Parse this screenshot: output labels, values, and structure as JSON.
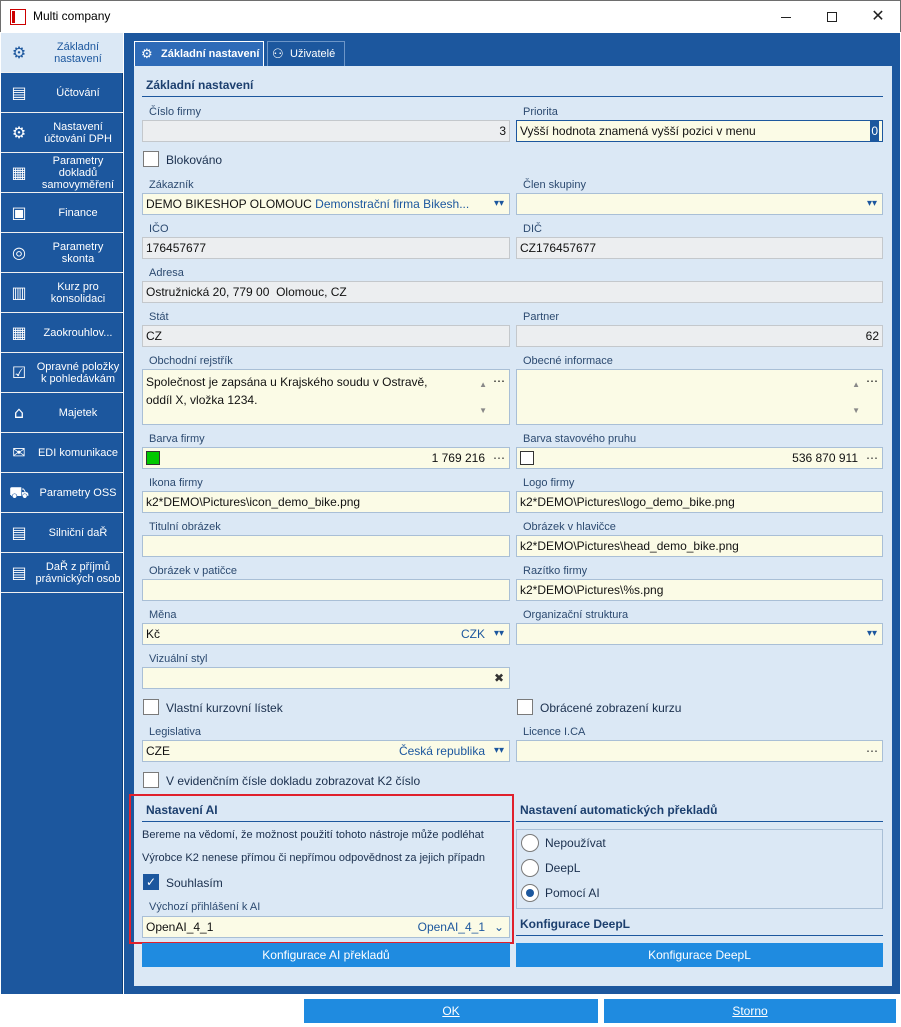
{
  "window": {
    "title": "Multi company"
  },
  "sidebar": {
    "items": [
      {
        "label": "Základní nastavení",
        "icon": "gear-icon",
        "glyph": "⚙"
      },
      {
        "label": "Účtování",
        "icon": "cash-register-icon",
        "glyph": "▤"
      },
      {
        "label": "Nastavení účtování DPH",
        "icon": "tax-settings-icon",
        "glyph": "⚙"
      },
      {
        "label": "Parametry dokladů samovyměření",
        "icon": "document-icon",
        "glyph": "▦"
      },
      {
        "label": "Finance",
        "icon": "printer-icon",
        "glyph": "▣"
      },
      {
        "label": "Parametry skonta",
        "icon": "coins-icon",
        "glyph": "◎"
      },
      {
        "label": "Kurz pro konsolidaci",
        "icon": "chart-document-icon",
        "glyph": "▥"
      },
      {
        "label": "Zaokrouhlov...",
        "icon": "calculator-icon",
        "glyph": "▦"
      },
      {
        "label": "Opravné položky k pohledávkám",
        "icon": "checklist-icon",
        "glyph": "☑"
      },
      {
        "label": "Majetek",
        "icon": "house-icon",
        "glyph": "⌂"
      },
      {
        "label": "EDI komunikace",
        "icon": "mail-settings-icon",
        "glyph": "✉"
      },
      {
        "label": "Parametry OSS",
        "icon": "cart-icon",
        "glyph": "⛟"
      },
      {
        "label": "Silniční daŘ",
        "icon": "road-tax-icon",
        "glyph": "▤"
      },
      {
        "label": "DaŘ z příjmů právnických osob",
        "icon": "tax-document-icon",
        "glyph": "▤"
      }
    ]
  },
  "tabs": [
    {
      "label": "Základní nastavení",
      "icon": "gear-icon",
      "glyph": "⚙"
    },
    {
      "label": "Uživatelé",
      "icon": "users-icon",
      "glyph": "⚇"
    }
  ],
  "main": {
    "section_title": "Základní nastavení",
    "cislo_firmy": {
      "label": "Číslo firmy",
      "value": "3"
    },
    "priorita": {
      "label": "Priorita",
      "value": "Vyšší hodnota znamená vyšší pozici v menu",
      "number": "0"
    },
    "blokovano": {
      "label": "Blokováno",
      "checked": false
    },
    "zakaznik": {
      "label": "Zákazník",
      "code": "DEMO BIKESHOP OLOMOUC",
      "name": "Demonstrační firma Bikesh..."
    },
    "clen_skupiny": {
      "label": "Člen skupiny",
      "value": ""
    },
    "ico": {
      "label": "IČO",
      "value": "176457677"
    },
    "dic": {
      "label": "DIČ",
      "value": "CZ176457677"
    },
    "adresa": {
      "label": "Adresa",
      "value": "Ostružnická 20, 779 00  Olomouc, CZ"
    },
    "stat": {
      "label": "Stát",
      "value": "CZ"
    },
    "partner": {
      "label": "Partner",
      "value": "62"
    },
    "obchodni_rejstrik": {
      "label": "Obchodní rejstřík",
      "line1": "Společnost je zapsána u Krajského soudu v Ostravě,",
      "line2": "oddíl X, vložka 1234."
    },
    "obecne_informace": {
      "label": "Obecné informace",
      "value": ""
    },
    "barva_firmy": {
      "label": "Barva firmy",
      "value": "1 769 216",
      "color": "#00c800"
    },
    "barva_stavoveho_pruhu": {
      "label": "Barva stavového pruhu",
      "value": "536 870 911",
      "color": "#ffffff"
    },
    "ikona_firmy": {
      "label": "Ikona firmy",
      "value": "k2*DEMO\\Pictures\\icon_demo_bike.png"
    },
    "logo_firmy": {
      "label": "Logo firmy",
      "value": "k2*DEMO\\Pictures\\logo_demo_bike.png"
    },
    "titulni_obrazek": {
      "label": "Titulní obrázek",
      "value": ""
    },
    "obrazek_v_hlavicce": {
      "label": "Obrázek v hlavičce",
      "value": "k2*DEMO\\Pictures\\head_demo_bike.png"
    },
    "obrazek_v_paticce": {
      "label": "Obrázek v patičce",
      "value": ""
    },
    "razitko_firmy": {
      "label": "Razítko firmy",
      "value": "k2*DEMO\\Pictures\\%s.png"
    },
    "mena": {
      "label": "Měna",
      "value": "Kč",
      "code": "CZK"
    },
    "organizacni_struktura": {
      "label": "Organizační struktura",
      "value": ""
    },
    "vizualni_styl": {
      "label": "Vizuální styl",
      "value": ""
    },
    "vlastni_kurzovni_listek": {
      "label": "Vlastní kurzovní lístek",
      "checked": false
    },
    "obracene_zobrazeni_kurzu": {
      "label": "Obrácené zobrazení kurzu",
      "checked": false
    },
    "legislativa": {
      "label": "Legislativa",
      "code": "CZE",
      "name": "Česká republika"
    },
    "licence_ica": {
      "label": "Licence I.CA",
      "value": ""
    },
    "evidencni_cislo": {
      "label": "V evidenčním čísle dokladu zobrazovat K2 číslo",
      "checked": false
    }
  },
  "ai": {
    "title": "Nastavení AI",
    "text1": "Bereme na vědomí, že možnost použití tohoto nástroje může podléhat",
    "text2": "Výrobce K2 nenese přímou či nepřímou odpovědnost za jejich případn",
    "souhlasim": "Souhlasím",
    "login_label": "Výchozí přihlášení k AI",
    "login_value": "OpenAI_4_1",
    "login_value2": "OpenAI_4_1",
    "config_button": "Konfigurace AI překladů"
  },
  "translation": {
    "title": "Nastavení automatických překladů",
    "options": [
      "Nepoužívat",
      "DeepL",
      "Pomocí AI"
    ],
    "selected": 2,
    "deepl_title": "Konfigurace DeepL",
    "deepl_button": "Konfigurace DeepL"
  },
  "footer": {
    "ok": "OK",
    "storno": "Storno"
  },
  "colors": {
    "accent": "#1c579e",
    "panel": "#dbe8f5",
    "button": "#1f8be0",
    "field": "#fbfbe6",
    "highlight": "#e0202c"
  }
}
